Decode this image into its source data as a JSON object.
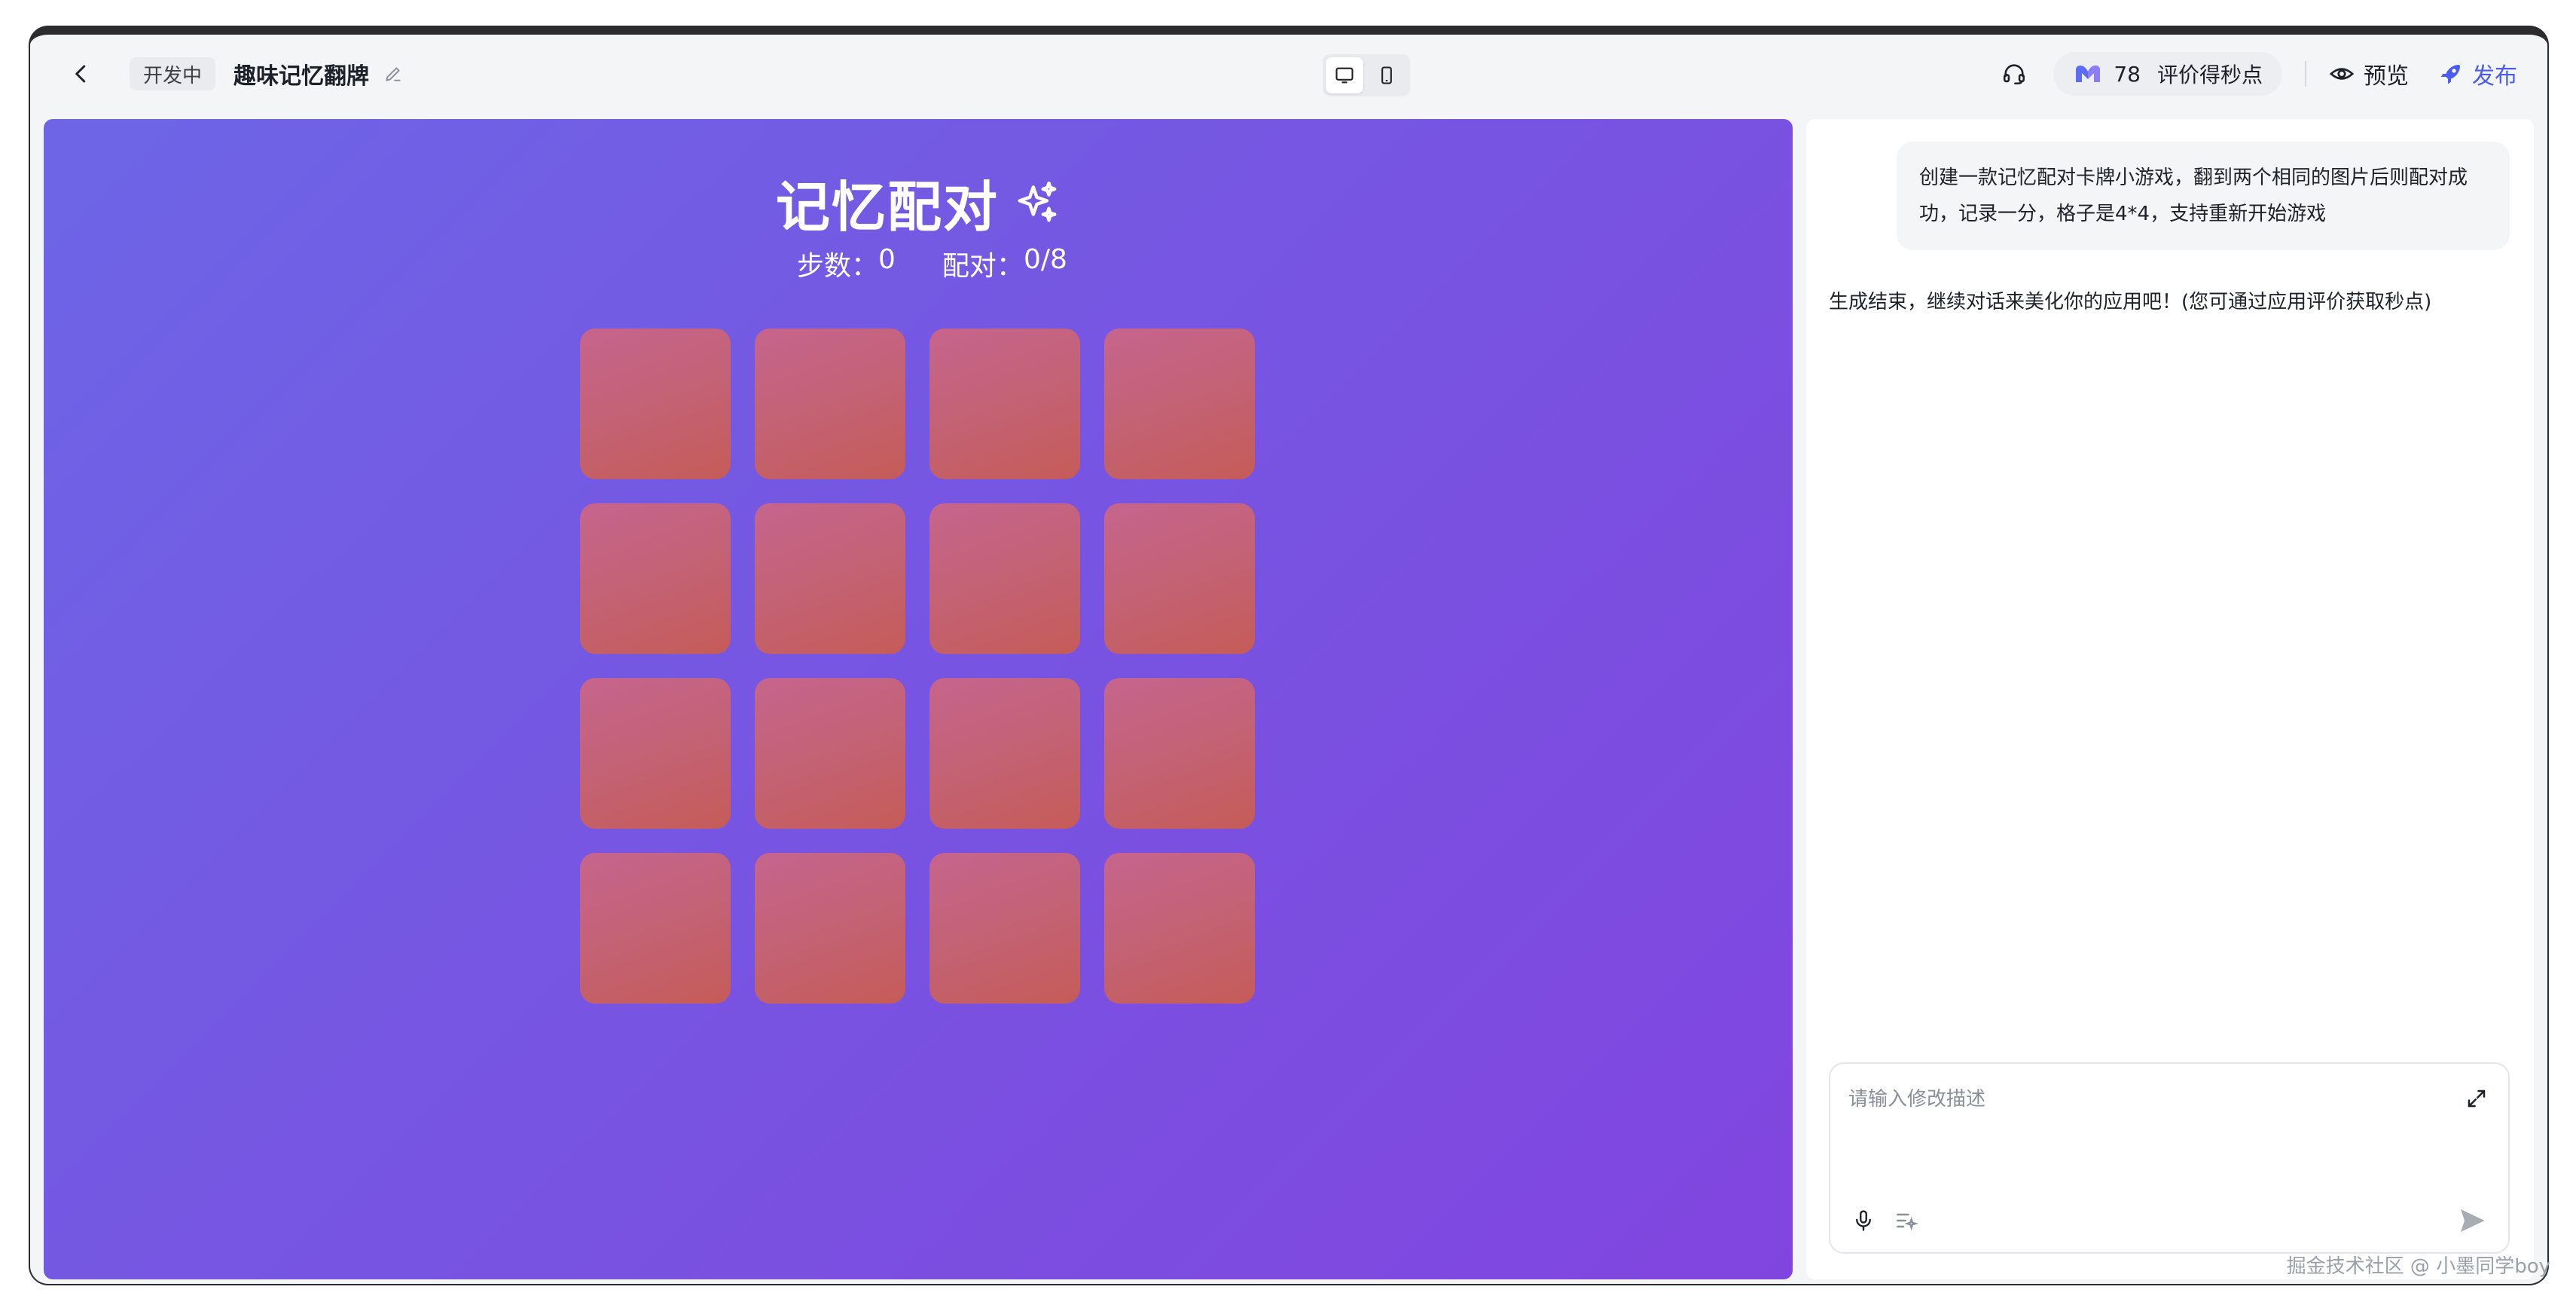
{
  "topbar": {
    "status_badge": "开发中",
    "project_title": "趣味记忆翻牌",
    "points_value": "78",
    "points_label": "评价得秒点",
    "preview_label": "预览",
    "publish_label": "发布",
    "accent_color": "#4d5cf0"
  },
  "game": {
    "title": "记忆配对",
    "steps_label": "步数：",
    "steps_value": "0",
    "pairs_label": "配对：",
    "pairs_value": "0/8",
    "card_count": 16
  },
  "chat": {
    "user_message": "创建一款记忆配对卡牌小游戏，翻到两个相同的图片后则配对成功，记录一分，格子是4*4，支持重新开始游戏",
    "ai_message": "生成结束，继续对话来美化你的应用吧！(您可通过应用评价获取秒点)",
    "input_placeholder": "请输入修改描述"
  },
  "watermark": "掘金技术社区 @ 小墨同学boy"
}
